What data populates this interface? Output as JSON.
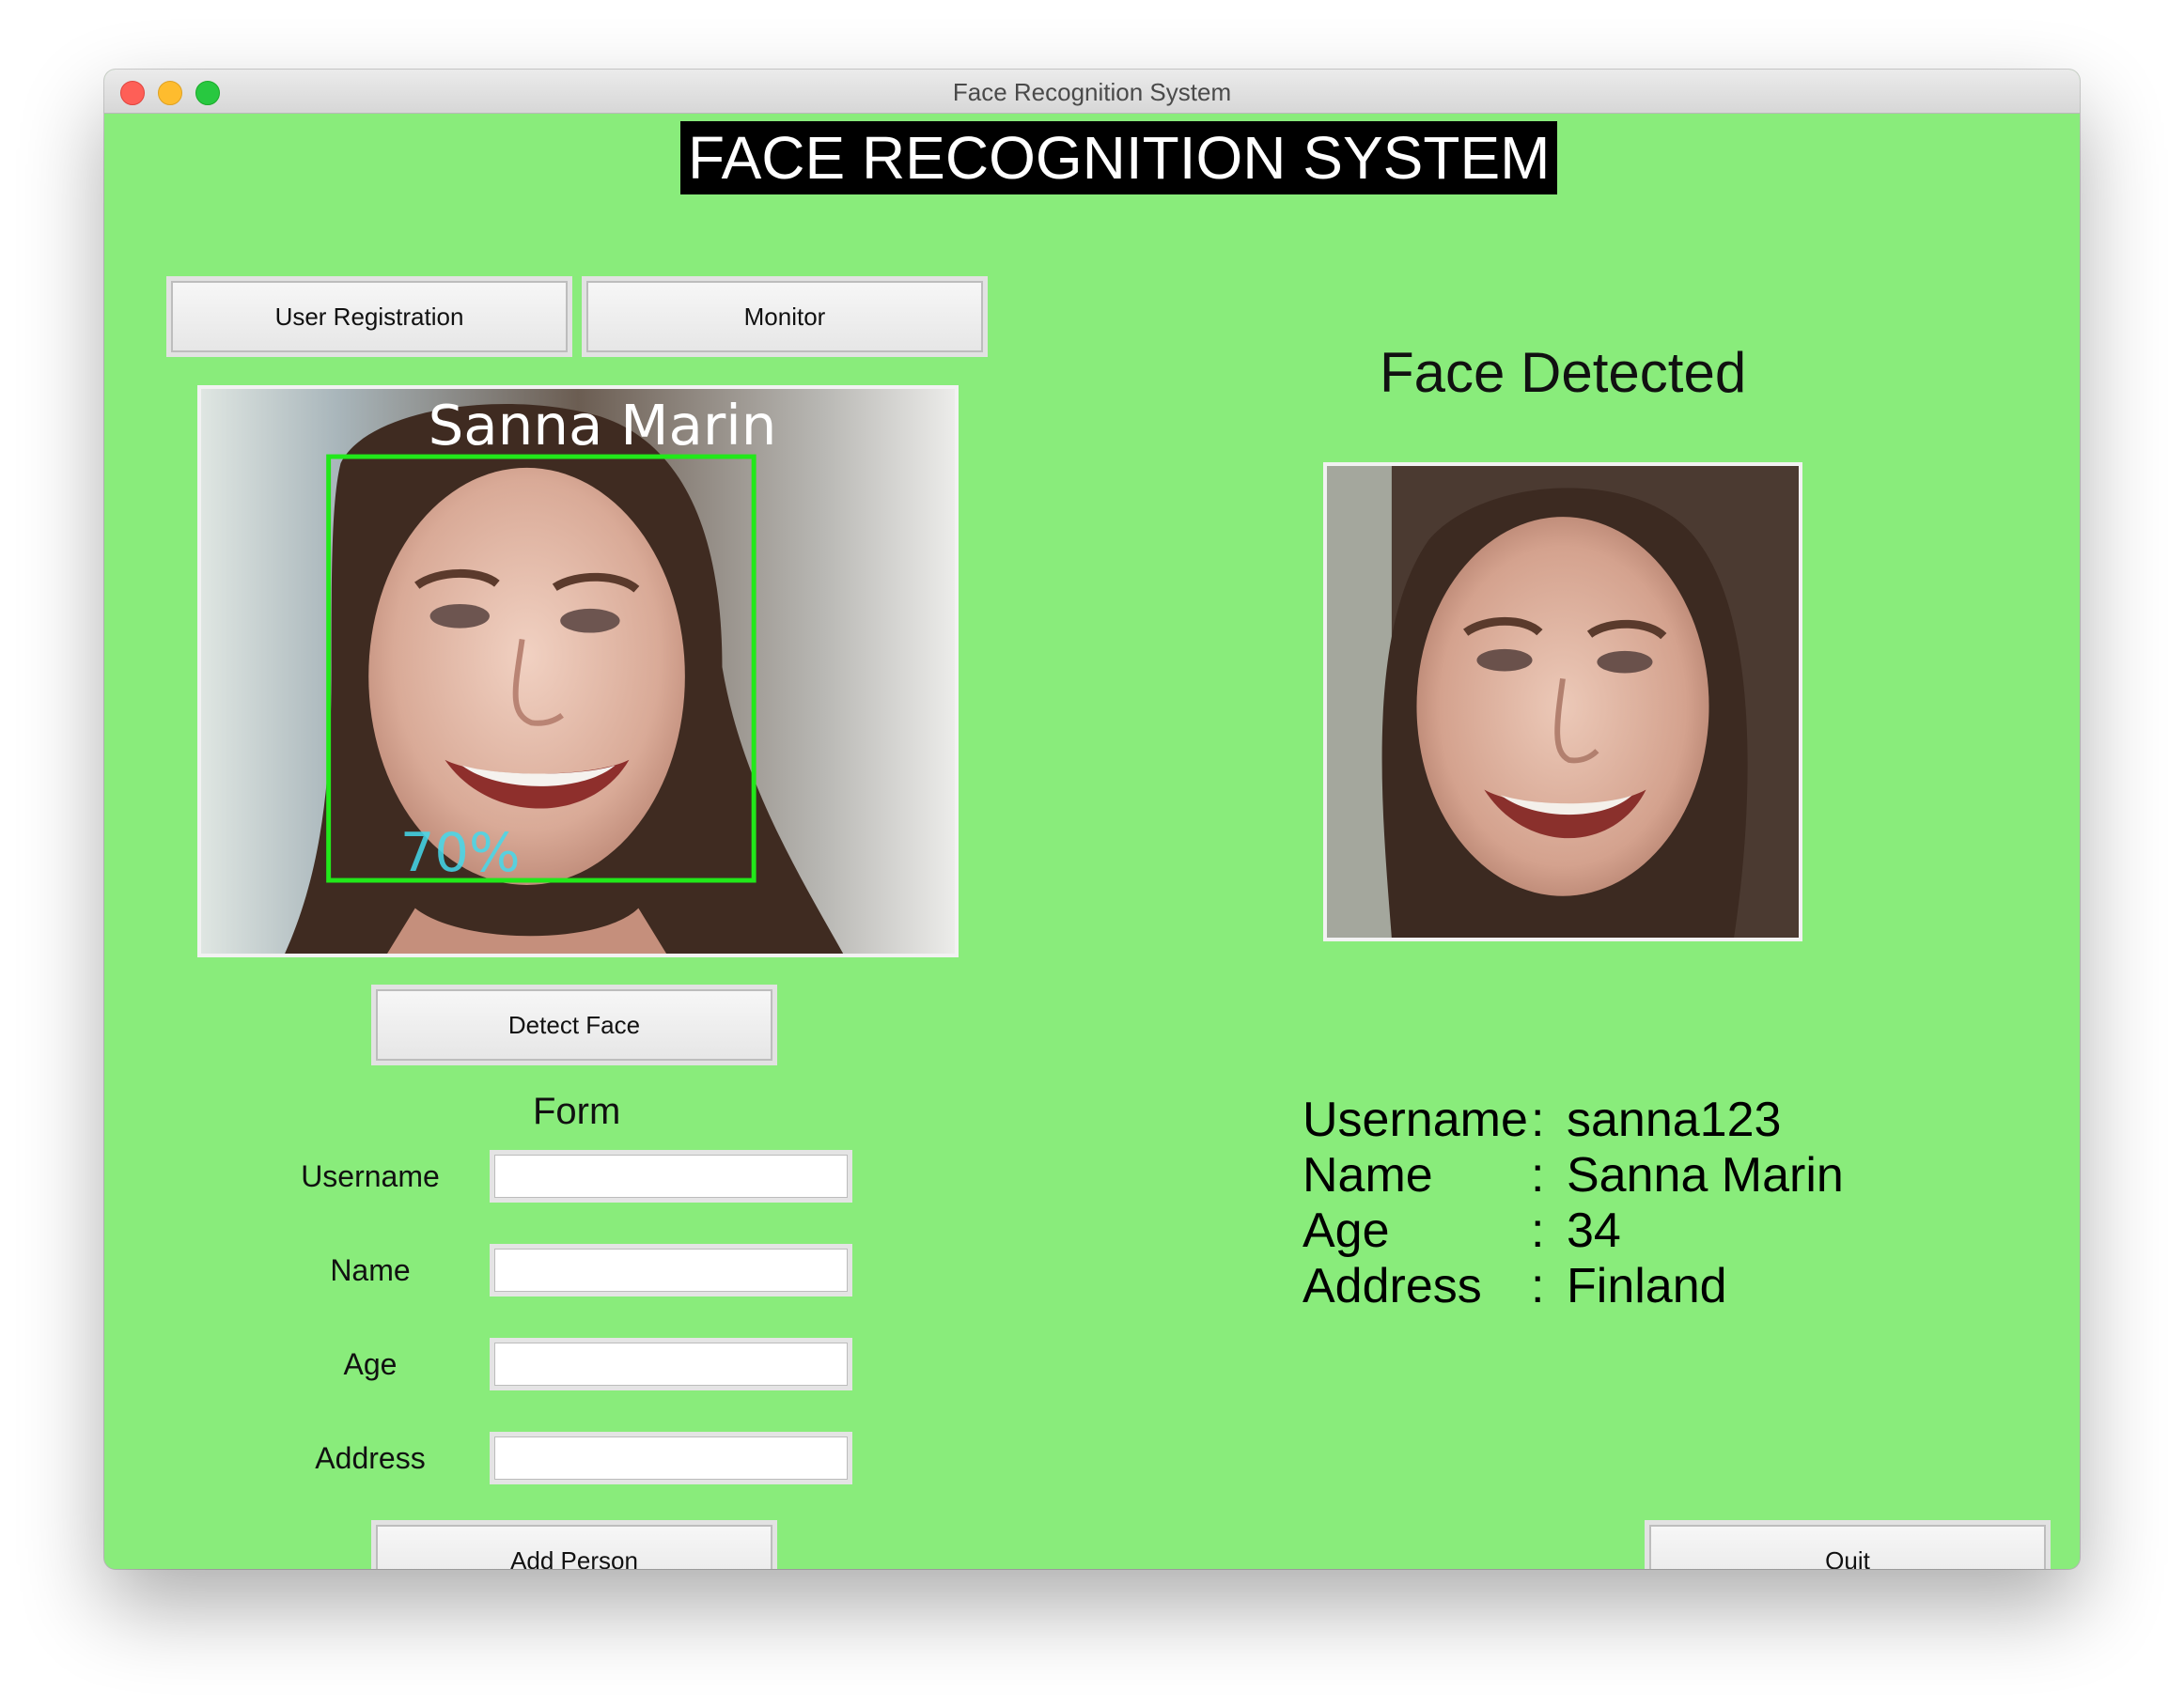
{
  "window": {
    "title": "Face Recognition System"
  },
  "header": {
    "title": "FACE RECOGNITION SYSTEM"
  },
  "nav": {
    "registration_label": "User Registration",
    "monitor_label": "Monitor"
  },
  "camera": {
    "overlay_name": "Sanna Marin",
    "confidence": "70%"
  },
  "actions": {
    "detect_label": "Detect Face",
    "add_label": "Add Person",
    "quit_label": "Quit"
  },
  "form": {
    "title": "Form",
    "fields": [
      {
        "label": "Username",
        "value": ""
      },
      {
        "label": "Name",
        "value": ""
      },
      {
        "label": "Age",
        "value": ""
      },
      {
        "label": "Address",
        "value": ""
      }
    ]
  },
  "result": {
    "status": "Face Detected",
    "rows": [
      {
        "key": "Username",
        "colon": ":",
        "value": "sanna123"
      },
      {
        "key": "Name",
        "colon": ":",
        "value": "Sanna Marin"
      },
      {
        "key": "Age",
        "colon": ":",
        "value": "34"
      },
      {
        "key": "Address",
        "colon": ":",
        "value": "Finland"
      }
    ]
  },
  "colors": {
    "background": "#89ec7b",
    "title_bg": "#000000",
    "box": "#22e81a",
    "confidence": "#43d9ec"
  }
}
